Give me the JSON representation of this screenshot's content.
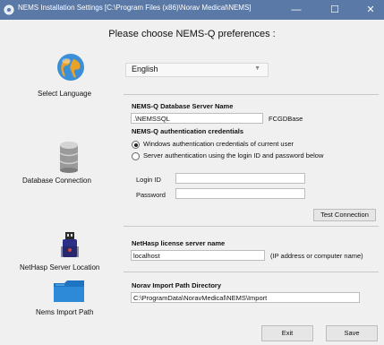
{
  "window": {
    "title": "NEMS Installation Settings [C:\\Program Files (x86)\\Norav Medical\\NEMS]",
    "minimize_glyph": "—",
    "maximize_glyph": "☐",
    "close_glyph": "✕",
    "titlebar_color": "#5a79a6"
  },
  "heading": "Please choose NEMS-Q preferences :",
  "sections": {
    "language": {
      "label": "Select Language",
      "icon": "globe-icon",
      "selected": "English",
      "arrow": "▼"
    },
    "database": {
      "label": "Database Connection",
      "icon": "database-icon",
      "server_name_label": "NEMS-Q Database Server Name",
      "server_name_value": ".\\NEMSSQL",
      "db_name": "FCGDBase",
      "auth_label": "NEMS-Q authentication credentials",
      "auth_options": [
        "Windows authentication credentials of current user",
        "Server authentication using the login ID and password below"
      ],
      "auth_selected_index": 0,
      "login_label": "Login ID",
      "login_value": "",
      "password_label": "Password",
      "password_value": "",
      "test_button": "Test Connection"
    },
    "nethasp": {
      "label": "NetHasp Server Location",
      "icon": "usb-key-icon",
      "field_label": "NetHasp license server name",
      "field_value": "localhost",
      "hint": "(IP address or computer name)"
    },
    "import": {
      "label": "Nems Import Path",
      "icon": "folder-icon",
      "field_label": "Norav Import Path Directory",
      "field_value": "C:\\ProgramData\\NoravMedical\\NEMS\\Import"
    }
  },
  "buttons": {
    "exit": "Exit",
    "save": "Save"
  }
}
